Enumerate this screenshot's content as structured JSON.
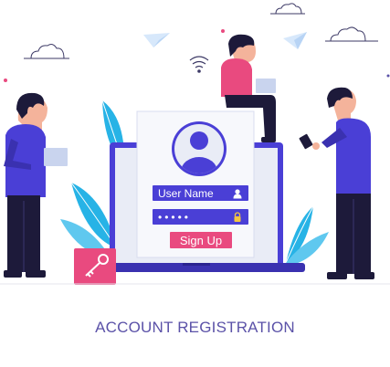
{
  "form": {
    "username_placeholder": "User Name",
    "password_mask": "•••••",
    "signup_label": "Sign Up"
  },
  "caption": "ACCOUNT REGISTRATION",
  "colors": {
    "primary": "#4a3fd6",
    "accent": "#e94a7f",
    "screen": "#e9ecf6",
    "leaf": "#27b3e6",
    "caption": "#5b52a8"
  },
  "icons": [
    "user-avatar-icon",
    "person-icon",
    "lock-icon",
    "key-icon",
    "wifi-icon",
    "paper-plane-icon",
    "cloud-icon"
  ]
}
